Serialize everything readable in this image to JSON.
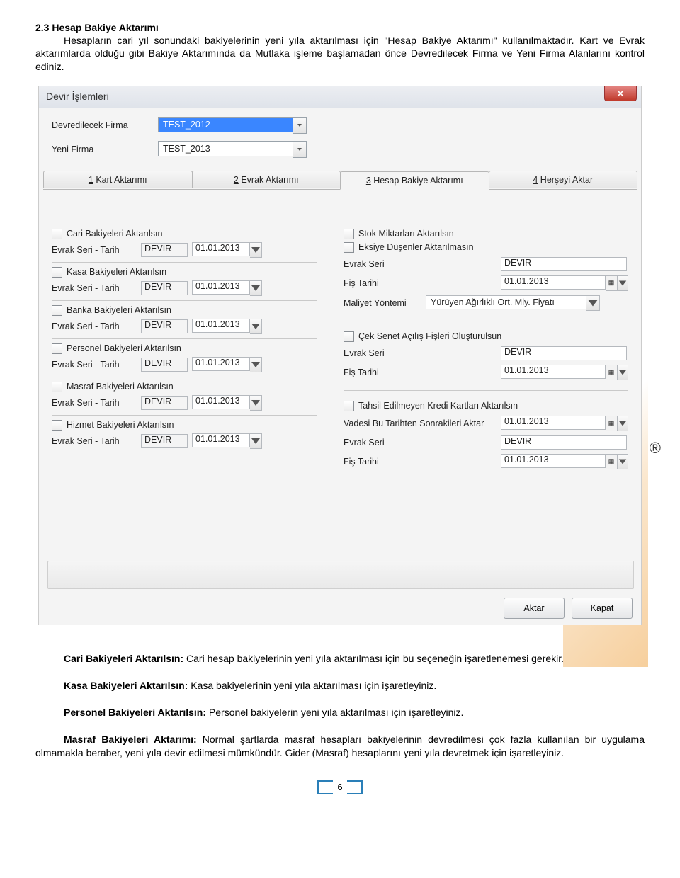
{
  "doc": {
    "section_title": "2.3 Hesap Bakiye Aktarımı",
    "intro_line1": "Hesapların cari yıl sonundaki bakiyelerinin yeni yıla aktarılması için \"Hesap Bakiye Aktarımı\" kullanılmaktadır. Kart",
    "intro_line2": "ve Evrak aktarımlarda olduğu gibi Bakiye Aktarımında da Mutlaka işleme başlamadan önce Devredilecek Firma ve Yeni Firma Alanlarını kontrol ediniz.",
    "p2_label": "Cari Bakiyeleri Aktarılsın:",
    "p2_text": " Cari hesap bakiyelerinin yeni yıla aktarılması için bu seçeneğin işaretlenemesi gerekir.",
    "p3_label": "Kasa Bakiyeleri Aktarılsın:",
    "p3_text": " Kasa bakiyelerinin yeni yıla aktarılması için işaretleyiniz.",
    "p4_label": "Personel Bakiyeleri Aktarılsın:",
    "p4_text": " Personel bakiyelerin yeni yıla aktarılması için işaretleyiniz.",
    "p5_label": "Masraf Bakiyeleri Aktarımı:",
    "p5_text": " Normal şartlarda masraf hesapları bakiyelerinin devredilmesi çok fazla kullanılan bir uygulama olmamakla beraber, yeni yıla devir edilmesi mümkündür. Gider (Masraf) hesaplarını yeni yıla devretmek için işaretleyiniz.",
    "page_number": "6"
  },
  "dlg": {
    "title": "Devir İşlemleri",
    "firma1_label": "Devredilecek Firma",
    "firma1_value": "TEST_2012",
    "firma2_label": "Yeni Firma",
    "firma2_value": "TEST_2013",
    "tabs": {
      "t1_u": "1",
      "t1": " Kart Aktarımı",
      "t2_u": "2",
      "t2": " Evrak Aktarımı",
      "t3_u": "3",
      "t3": " Hesap Bakiye Aktarımı",
      "t4_u": "4",
      "t4": " Herşeyi Aktar"
    },
    "labels": {
      "evrak_seri_tarih": "Evrak Seri - Tarih",
      "seri_val": "DEVIR",
      "date_val": "01.01.2013",
      "evrak_seri": "Evrak Seri",
      "fis_tarihi": "Fiş Tarihi",
      "maliyet": "Maliyet Yöntemi",
      "maliyet_val": "Yürüyen Ağırlıklı Ort. Mly. Fiyatı",
      "vadesi": "Vadesi Bu Tarihten Sonrakileri Aktar"
    },
    "left": {
      "chk1": "Cari Bakiyeleri Aktarılsın",
      "chk2": "Kasa Bakiyeleri Aktarılsın",
      "chk3": "Banka Bakiyeleri Aktarılsın",
      "chk4": "Personel Bakiyeleri Aktarılsın",
      "chk5": "Masraf Bakiyeleri Aktarılsın",
      "chk6": "Hizmet Bakiyeleri Aktarılsın"
    },
    "right": {
      "chk1": "Stok Miktarları Aktarılsın",
      "chk2": "Eksiye Düşenler Aktarılmasın",
      "chk3": "Çek Senet Açılış Fişleri Oluşturulsun",
      "chk4": "Tahsil Edilmeyen Kredi Kartları Aktarılsın"
    },
    "buttons": {
      "aktar": "Aktar",
      "kapat": "Kapat"
    }
  }
}
